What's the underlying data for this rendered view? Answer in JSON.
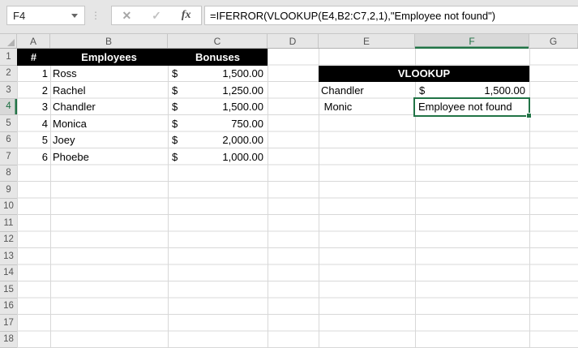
{
  "name_box": {
    "value": "F4"
  },
  "formula_bar": {
    "formula": "=IFERROR(VLOOKUP(E4,B2:C7,2,1),\"Employee not found\")",
    "icons": {
      "cancel": "✕",
      "enter": "✓",
      "fx": "fx",
      "dots": "⋮"
    }
  },
  "sheet": {
    "column_headers": [
      "A",
      "B",
      "C",
      "D",
      "E",
      "F",
      "G"
    ],
    "row_headers": [
      "1",
      "2",
      "3",
      "4",
      "5",
      "6",
      "7",
      "8",
      "9",
      "10",
      "11",
      "12",
      "13",
      "14",
      "15",
      "16",
      "17",
      "18"
    ],
    "selected": {
      "cell": "F4",
      "column": "F",
      "row": "4"
    }
  },
  "employee_table": {
    "header": {
      "num": "#",
      "employees": "Employees",
      "bonuses": "Bonuses"
    },
    "rows": [
      {
        "num": "1",
        "name": "Ross",
        "cur": "$",
        "amount": "1,500.00"
      },
      {
        "num": "2",
        "name": "Rachel",
        "cur": "$",
        "amount": "1,250.00"
      },
      {
        "num": "3",
        "name": "Chandler",
        "cur": "$",
        "amount": "1,500.00"
      },
      {
        "num": "4",
        "name": "Monica",
        "cur": "$",
        "amount": "750.00"
      },
      {
        "num": "5",
        "name": "Joey",
        "cur": "$",
        "amount": "2,000.00"
      },
      {
        "num": "6",
        "name": "Phoebe",
        "cur": "$",
        "amount": "1,000.00"
      }
    ]
  },
  "vlookup_panel": {
    "title": "VLOOKUP",
    "found": {
      "key": "Chandler",
      "cur": "$",
      "amount": "1,500.00"
    },
    "not_found": {
      "key": " Monic",
      "result": "Employee not found"
    }
  },
  "colors": {
    "accent_green": "#217346",
    "table_header_fill": "#000000"
  }
}
